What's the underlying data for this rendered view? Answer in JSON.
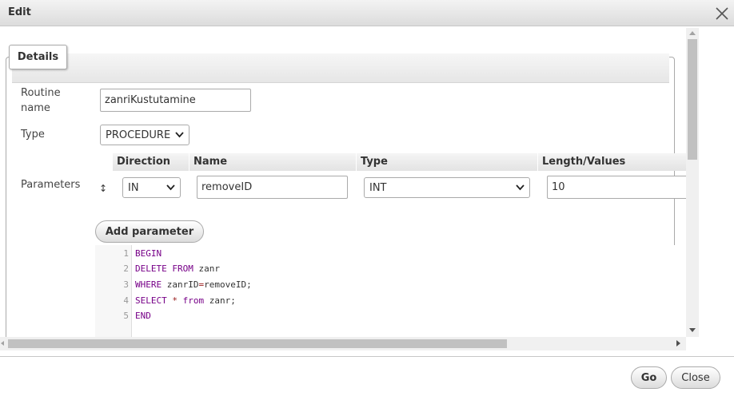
{
  "dialog": {
    "title": "Edit",
    "tab": "Details"
  },
  "form": {
    "routine_name_label": "Routine name",
    "routine_name_value": "zanriKustutamine",
    "type_label": "Type",
    "type_value": "PROCEDURE",
    "parameters_label": "Parameters",
    "parameter_headers": [
      "Direction",
      "Name",
      "Type",
      "Length/Values"
    ],
    "parameter_row": {
      "direction": "IN",
      "name": "removeID",
      "type": "INT",
      "length": "10"
    },
    "drag_handle": "↕",
    "add_parameter_label": "Add parameter"
  },
  "editor": {
    "line_numbers": [
      "1",
      "2",
      "3",
      "4",
      "5"
    ],
    "lines": [
      [
        {
          "t": "BEGIN",
          "c": "kw"
        }
      ],
      [
        {
          "t": "DELETE FROM",
          "c": "kw"
        },
        {
          "t": " zanr",
          "c": ""
        }
      ],
      [
        {
          "t": "WHERE",
          "c": "kw"
        },
        {
          "t": " zanrID",
          "c": ""
        },
        {
          "t": "=",
          "c": "op"
        },
        {
          "t": "removeID;",
          "c": ""
        }
      ],
      [
        {
          "t": "SELECT",
          "c": "kw"
        },
        {
          "t": " ",
          "c": ""
        },
        {
          "t": "*",
          "c": "op"
        },
        {
          "t": " ",
          "c": ""
        },
        {
          "t": "from",
          "c": "kw"
        },
        {
          "t": " zanr;",
          "c": ""
        }
      ],
      [
        {
          "t": "END",
          "c": "kw"
        }
      ]
    ]
  },
  "footer": {
    "go_label": "Go",
    "close_label": "Close"
  },
  "colors": {
    "keyword": "#770088",
    "operator": "#981a1a"
  }
}
